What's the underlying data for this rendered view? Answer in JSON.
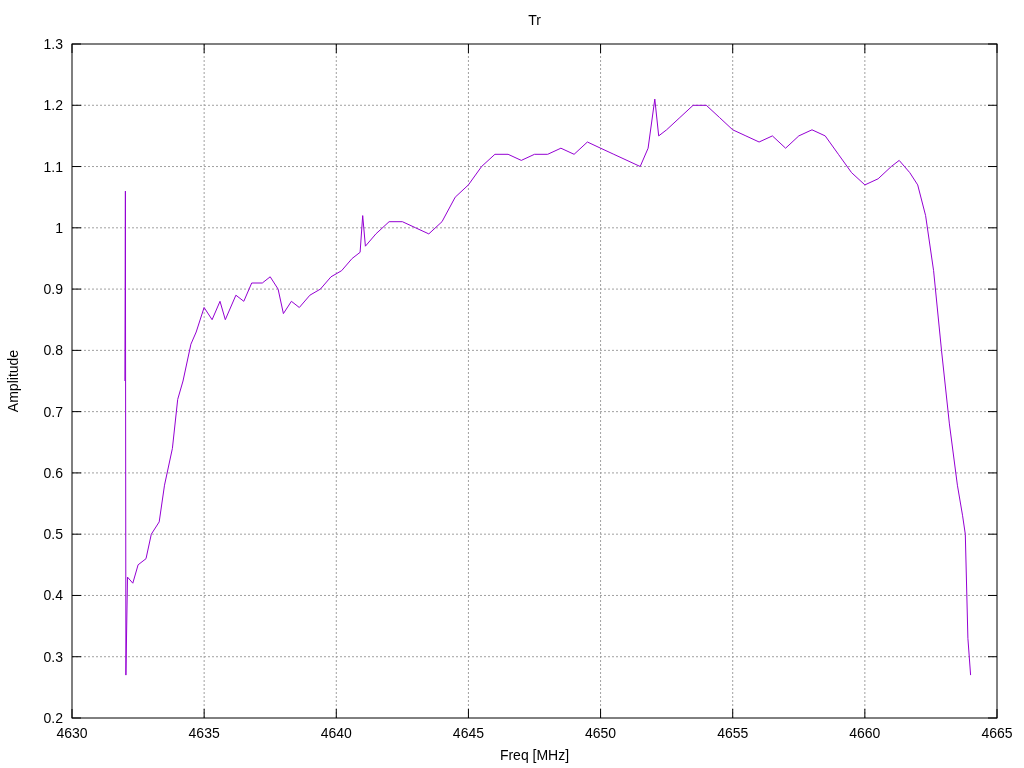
{
  "chart_data": {
    "type": "line",
    "title": "Tr",
    "xlabel": "Freq [MHz]",
    "ylabel": "Amplitude",
    "grid": true,
    "xlim": [
      4630,
      4665
    ],
    "ylim": [
      0.2,
      1.3
    ],
    "xticks": [
      4630,
      4635,
      4640,
      4645,
      4650,
      4655,
      4660,
      4665
    ],
    "yticks": [
      0.2,
      0.3,
      0.4,
      0.5,
      0.6,
      0.7,
      0.8,
      0.9,
      1,
      1.1,
      1.2,
      1.3
    ],
    "x": [
      4632.0,
      4632.02,
      4632.04,
      4632.1,
      4632.3,
      4632.5,
      4632.8,
      4633.0,
      4633.3,
      4633.5,
      4633.8,
      4634.0,
      4634.2,
      4634.5,
      4634.7,
      4635.0,
      4635.3,
      4635.6,
      4635.8,
      4636.2,
      4636.5,
      4636.8,
      4637.2,
      4637.5,
      4637.8,
      4638.0,
      4638.3,
      4638.6,
      4639.0,
      4639.4,
      4639.8,
      4640.2,
      4640.6,
      4640.9,
      4641.0,
      4641.1,
      4641.5,
      4642.0,
      4642.5,
      4643.0,
      4643.5,
      4644.0,
      4644.5,
      4645.0,
      4645.5,
      4646.0,
      4646.5,
      4647.0,
      4647.5,
      4648.0,
      4648.5,
      4649.0,
      4649.5,
      4650.0,
      4650.5,
      4651.0,
      4651.5,
      4651.8,
      4652.05,
      4652.2,
      4652.5,
      4653.0,
      4653.5,
      4654.0,
      4654.5,
      4655.0,
      4655.5,
      4656.0,
      4656.5,
      4657.0,
      4657.5,
      4658.0,
      4658.5,
      4659.0,
      4659.5,
      4660.0,
      4660.5,
      4661.0,
      4661.3,
      4661.7,
      4662.0,
      4662.3,
      4662.6,
      4662.9,
      4663.2,
      4663.5,
      4663.7,
      4663.8,
      4663.9,
      4664.0
    ],
    "series": [
      {
        "color": "#9400d3",
        "values": [
          0.75,
          1.06,
          0.27,
          0.43,
          0.42,
          0.45,
          0.46,
          0.5,
          0.52,
          0.58,
          0.64,
          0.72,
          0.75,
          0.81,
          0.83,
          0.87,
          0.85,
          0.88,
          0.85,
          0.89,
          0.88,
          0.91,
          0.91,
          0.92,
          0.9,
          0.86,
          0.88,
          0.87,
          0.89,
          0.9,
          0.92,
          0.93,
          0.95,
          0.96,
          1.02,
          0.97,
          0.99,
          1.01,
          1.01,
          1.0,
          0.99,
          1.01,
          1.05,
          1.07,
          1.1,
          1.12,
          1.12,
          1.11,
          1.12,
          1.12,
          1.13,
          1.12,
          1.14,
          1.13,
          1.12,
          1.11,
          1.1,
          1.13,
          1.21,
          1.15,
          1.16,
          1.18,
          1.2,
          1.2,
          1.18,
          1.16,
          1.15,
          1.14,
          1.15,
          1.13,
          1.15,
          1.16,
          1.15,
          1.12,
          1.09,
          1.07,
          1.08,
          1.1,
          1.11,
          1.09,
          1.07,
          1.02,
          0.93,
          0.8,
          0.68,
          0.58,
          0.53,
          0.5,
          0.33,
          0.27
        ]
      }
    ]
  }
}
